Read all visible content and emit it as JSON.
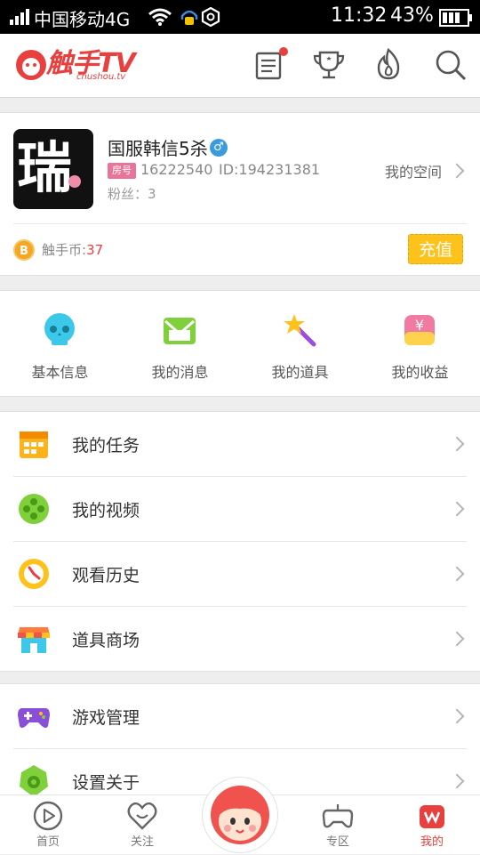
{
  "status_bar": {
    "carrier": "中国移动4G",
    "time": "11:32",
    "battery_pct": "43%"
  },
  "header": {
    "logo_text": "触手TV",
    "logo_sub": "chushou.tv",
    "has_notification_dot": true
  },
  "profile": {
    "avatar_glyph": "瑞",
    "username": "国服韩信5杀",
    "gender_symbol": "♂",
    "room_tag": "房号",
    "room_number": "16222540",
    "user_id": "ID:194231381",
    "fans": "粉丝：3",
    "my_space": "我的空间",
    "coin_symbol": "B",
    "coin_label": "触手币:",
    "coin_value": "37",
    "recharge": "充值"
  },
  "quick_actions": [
    {
      "label": "基本信息",
      "icon": "skull-icon"
    },
    {
      "label": "我的消息",
      "icon": "envelope-icon"
    },
    {
      "label": "我的道具",
      "icon": "magic-wand-icon"
    },
    {
      "label": "我的收益",
      "icon": "wallet-icon"
    }
  ],
  "menu_group_1": [
    {
      "label": "我的任务",
      "icon": "calendar-icon"
    },
    {
      "label": "我的视频",
      "icon": "film-reel-icon"
    },
    {
      "label": "观看历史",
      "icon": "clock-icon"
    },
    {
      "label": "道具商场",
      "icon": "shop-icon"
    }
  ],
  "menu_group_2": [
    {
      "label": "游戏管理",
      "icon": "gamepad-icon"
    },
    {
      "label": "设置关于",
      "icon": "settings-icon"
    }
  ],
  "bottom_nav": [
    {
      "label": "首页",
      "icon": "play-circle-icon",
      "active": false
    },
    {
      "label": "关注",
      "icon": "heart-icon",
      "active": false
    },
    {
      "label": "专区",
      "icon": "controller-icon",
      "active": false
    },
    {
      "label": "我的",
      "icon": "profile-icon",
      "active": true
    }
  ],
  "colors": {
    "brand_red": "#e8403e",
    "recharge_yellow": "#ffc21a",
    "coin_orange": "#f5a623"
  }
}
